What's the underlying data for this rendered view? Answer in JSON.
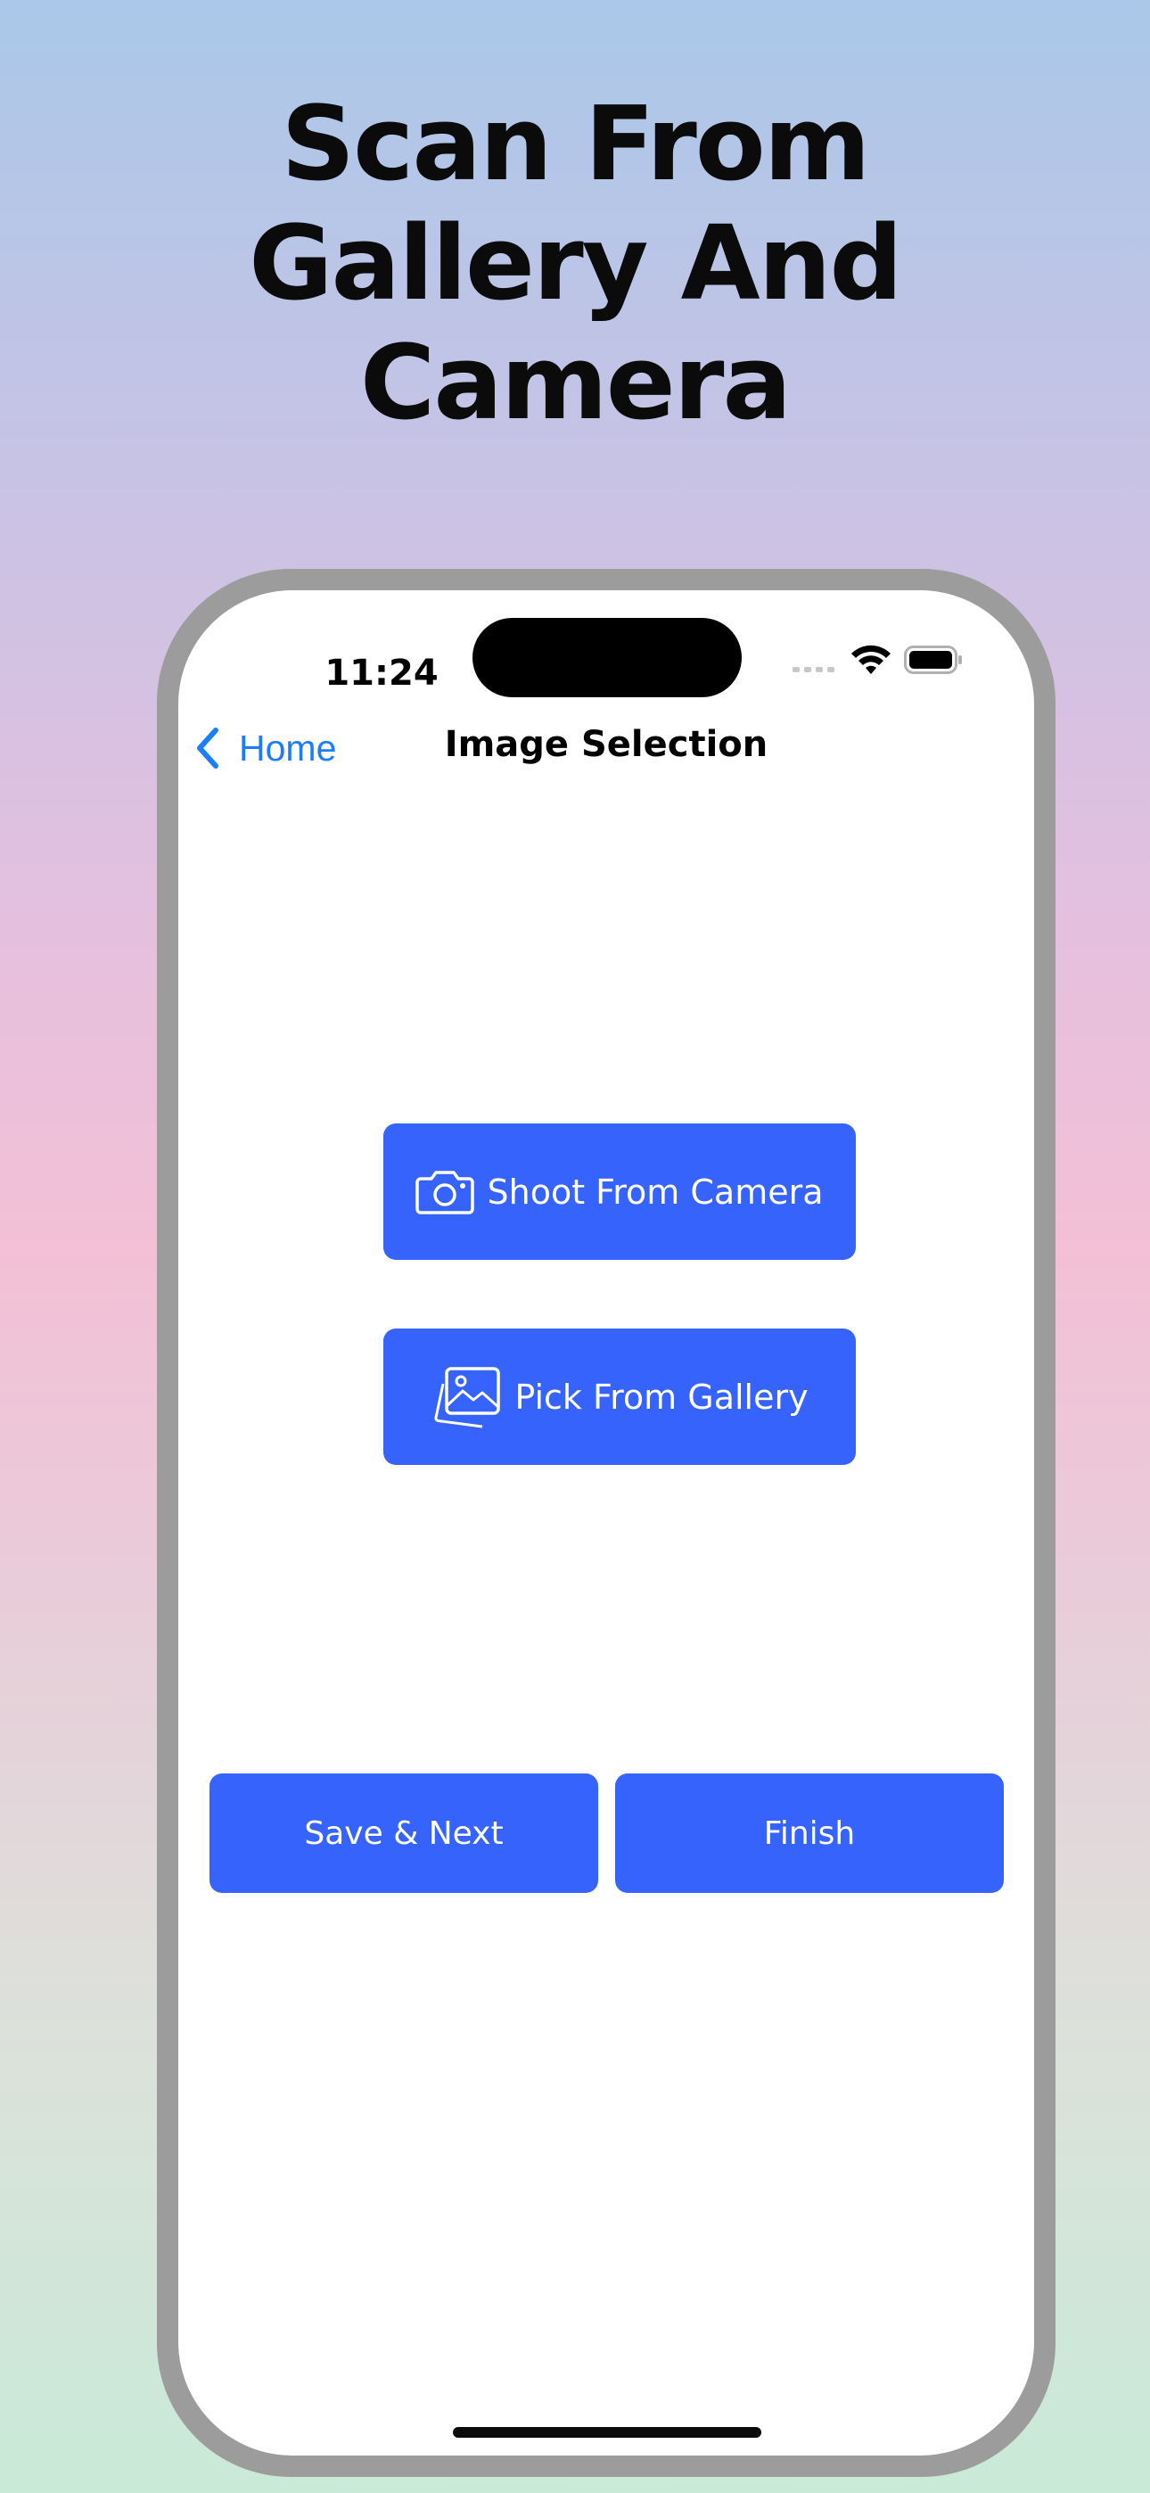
{
  "headline": {
    "line1": "Scan From",
    "line2": "Gallery And",
    "line3": "Camera"
  },
  "status_bar": {
    "time": "11:24"
  },
  "nav": {
    "back_label": "Home",
    "title": "Image Selection"
  },
  "actions": {
    "camera_label": "Shoot From Camera",
    "gallery_label": "Pick From Gallery",
    "save_label": "Save & Next",
    "finish_label": "Finish"
  },
  "colors": {
    "accent": "#3663fb",
    "link": "#1c7ef6",
    "frame": "#9c9c9c"
  },
  "icons": [
    "chevron-left-icon",
    "camera-icon",
    "photo-gallery-icon",
    "signal-icon",
    "wifi-icon",
    "battery-icon"
  ]
}
